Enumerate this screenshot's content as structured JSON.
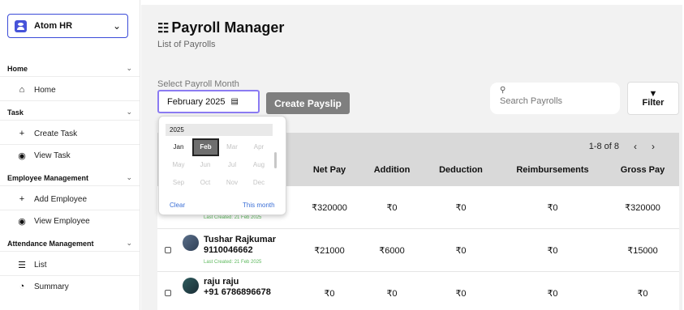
{
  "org": {
    "name": "Atom HR"
  },
  "sidebar": {
    "sections": [
      {
        "label": "Home",
        "items": [
          {
            "label": "Home",
            "icon": "home-icon"
          }
        ]
      },
      {
        "label": "Task",
        "items": [
          {
            "label": "Create Task",
            "icon": "plus-icon"
          },
          {
            "label": "View Task",
            "icon": "eye-icon"
          }
        ]
      },
      {
        "label": "Employee Management",
        "items": [
          {
            "label": "Add Employee",
            "icon": "plus-icon"
          },
          {
            "label": "View Employee",
            "icon": "eye-icon"
          }
        ]
      },
      {
        "label": "Attendance Management",
        "items": [
          {
            "label": "List",
            "icon": "list-icon"
          },
          {
            "label": "Summary",
            "icon": "pie-chart-icon"
          }
        ]
      }
    ]
  },
  "page": {
    "title": "Payroll Manager",
    "subtitle": "List of Payrolls",
    "month_label": "Select Payroll Month",
    "month_value": "February 2025",
    "create_button": "Create Payslip",
    "search_placeholder": "Search Payrolls",
    "filter_label": "Filter"
  },
  "picker": {
    "year": "2025",
    "months": [
      "Jan",
      "Feb",
      "Mar",
      "Apr",
      "May",
      "Jun",
      "Jul",
      "Aug",
      "Sep",
      "Oct",
      "Nov",
      "Dec"
    ],
    "selected": "Feb",
    "clear": "Clear",
    "this_month": "This month"
  },
  "table": {
    "pager": "1-8 of 8",
    "columns": [
      "Net Pay",
      "Addition",
      "Deduction",
      "Reimbursements",
      "Gross Pay"
    ],
    "rows": [
      {
        "name": "",
        "phone": "",
        "last_created": "Last Created: 21 Feb 2025",
        "net_pay": "₹320000",
        "addition": "₹0",
        "deduction": "₹0",
        "reimbursements": "₹0",
        "gross_pay": "₹320000"
      },
      {
        "name": "Tushar Rajkumar",
        "phone": "9110046662",
        "last_created": "Last Created: 21 Feb 2025",
        "net_pay": "₹21000",
        "addition": "₹6000",
        "deduction": "₹0",
        "reimbursements": "₹0",
        "gross_pay": "₹15000"
      },
      {
        "name": "raju raju",
        "phone": "+91 6786896678",
        "last_created": "",
        "net_pay": "₹0",
        "addition": "₹0",
        "deduction": "₹0",
        "reimbursements": "₹0",
        "gross_pay": "₹0"
      }
    ]
  },
  "colors": {
    "accent": "#3b4bd8",
    "focus": "#8b7bf2",
    "success_text": "#5cb85c",
    "link": "#3b6fd6"
  }
}
